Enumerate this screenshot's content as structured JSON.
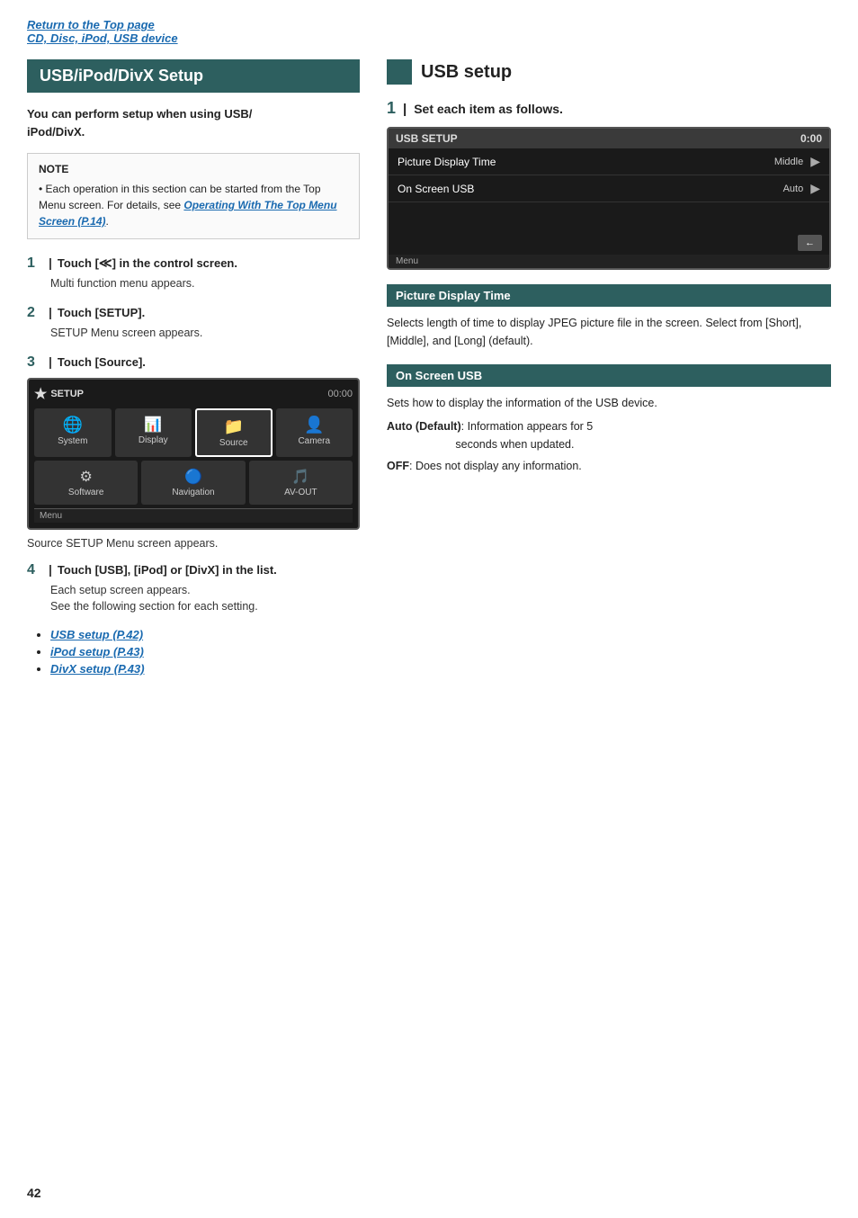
{
  "topLinks": {
    "link1": "Return to the Top page",
    "link2": "CD, Disc, iPod, USB device"
  },
  "leftCol": {
    "sectionTitle": "USB/iPod/DivX Setup",
    "introText": "You can perform setup when using USB/\niPod/DivX.",
    "note": {
      "title": "NOTE",
      "text": "• Each operation in this section can be started from the Top Menu screen. For details, see Operating With The Top Menu Screen (P.14)."
    },
    "noteLink": "Operating With The Top Menu Screen (P.14)",
    "steps": [
      {
        "num": "1",
        "label": "Touch [",
        "labelMid": "] in the control screen.",
        "desc": "Multi function menu appears."
      },
      {
        "num": "2",
        "label": "Touch [SETUP].",
        "desc": "SETUP Menu screen appears."
      },
      {
        "num": "3",
        "label": "Touch [Source].",
        "desc": ""
      }
    ],
    "setupScreen": {
      "logo": "SETUP",
      "time": "00:00",
      "icons": [
        {
          "label": "System",
          "icon": "🌐",
          "highlighted": false
        },
        {
          "label": "Display",
          "icon": "📺",
          "highlighted": false
        },
        {
          "label": "Source",
          "icon": "📂",
          "highlighted": true
        },
        {
          "label": "Camera",
          "icon": "👤",
          "highlighted": false
        }
      ],
      "icons2": [
        {
          "label": "Software",
          "icon": "⚙️",
          "highlighted": false
        },
        {
          "label": "Navigation",
          "icon": "🔵",
          "highlighted": false
        },
        {
          "label": "AV-OUT",
          "icon": "🎵",
          "highlighted": false
        }
      ],
      "menuLabel": "Menu"
    },
    "afterScreenText": "Source SETUP Menu screen appears.",
    "step4": {
      "num": "4",
      "label": "Touch [USB], [iPod] or [DivX] in the list.",
      "desc1": "Each setup screen appears.",
      "desc2": "See the following section for each setting."
    },
    "bulletLinks": [
      {
        "text": "USB setup (P.42)"
      },
      {
        "text": "iPod setup (P.43)"
      },
      {
        "text": "DivX setup (P.43)"
      }
    ]
  },
  "rightCol": {
    "iconColor": "#2d5f5f",
    "title": "USB setup",
    "step1": {
      "num": "1",
      "label": "Set each item as follows."
    },
    "usbScreen": {
      "titleBar": "USB SETUP",
      "time": "0:00",
      "rows": [
        {
          "label": "Picture Display Time",
          "value": "Middle",
          "hasArrow": true
        },
        {
          "label": "On Screen USB",
          "value": "Auto",
          "hasArrow": true
        }
      ],
      "menuLabel": "Menu"
    },
    "sections": [
      {
        "title": "Picture Display Time",
        "paragraphs": [
          "Selects length of time to display JPEG picture file in the screen. Select from [Short], [Middle], and [Long] (default)."
        ]
      },
      {
        "title": "On Screen USB",
        "paragraphs": [
          "Sets how to display the information of the USB device.",
          "Auto (Default): Information appears for 5\n                        seconds when updated.",
          "OFF: Does not display any information."
        ]
      }
    ]
  },
  "pageNumber": "42"
}
